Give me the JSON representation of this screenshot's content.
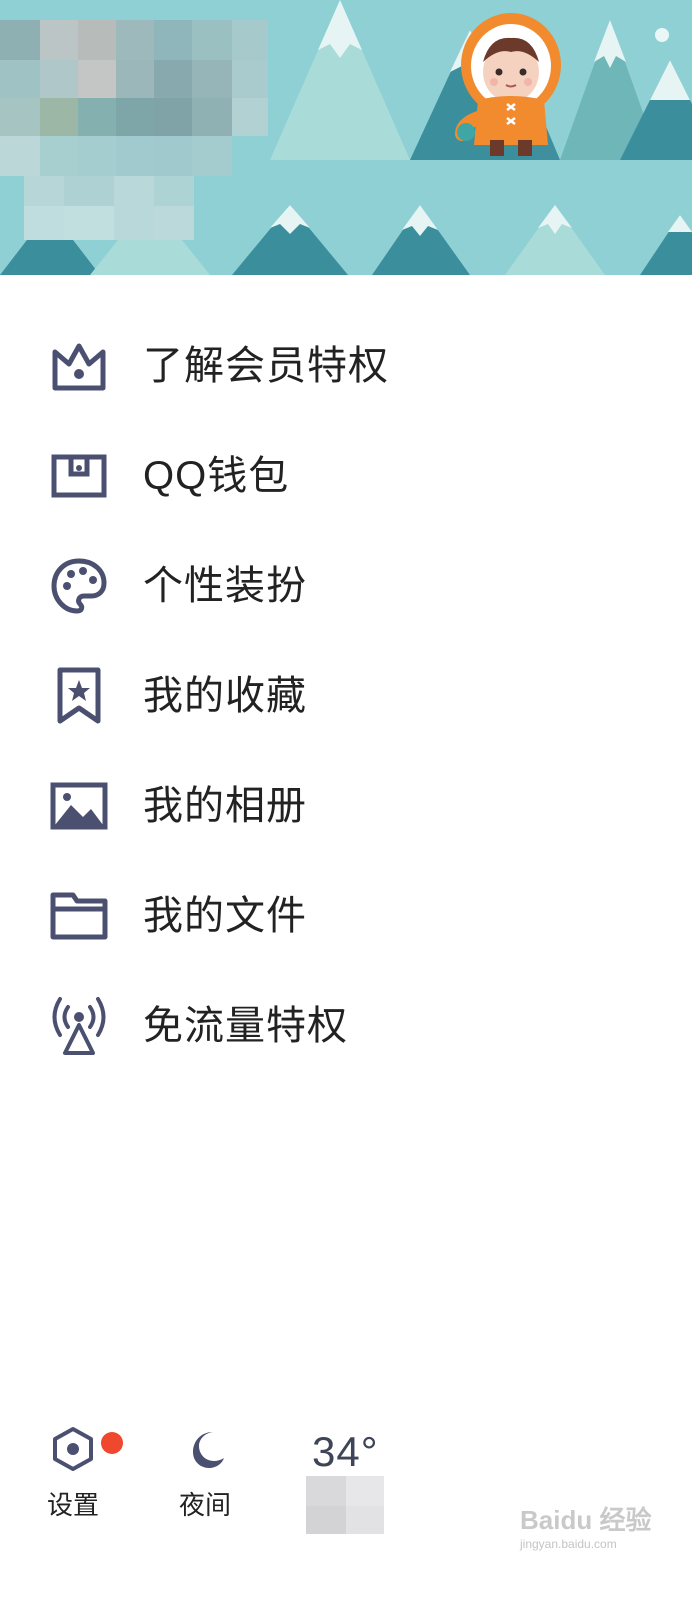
{
  "colors": {
    "banner_bg": "#8fd0d4",
    "icon": "#4b5070",
    "badge": "#f0472f"
  },
  "header": {
    "avatar_icon": "pixelated-profile-avatar",
    "decoration_icon": "eskimo-character-illustration"
  },
  "menu": {
    "items": [
      {
        "label": "了解会员特权",
        "icon": "crown-icon"
      },
      {
        "label": "QQ钱包",
        "icon": "wallet-icon"
      },
      {
        "label": "个性装扮",
        "icon": "palette-icon"
      },
      {
        "label": "我的收藏",
        "icon": "bookmark-star-icon"
      },
      {
        "label": "我的相册",
        "icon": "photo-album-icon"
      },
      {
        "label": "我的文件",
        "icon": "folder-icon"
      },
      {
        "label": "免流量特权",
        "icon": "signal-tower-icon"
      }
    ]
  },
  "bottom": {
    "settings_label": "设置",
    "night_label": "夜间",
    "temperature": "34°"
  },
  "watermark": {
    "brand": "Baidu 经验",
    "url": "jingyan.baidu.com"
  }
}
